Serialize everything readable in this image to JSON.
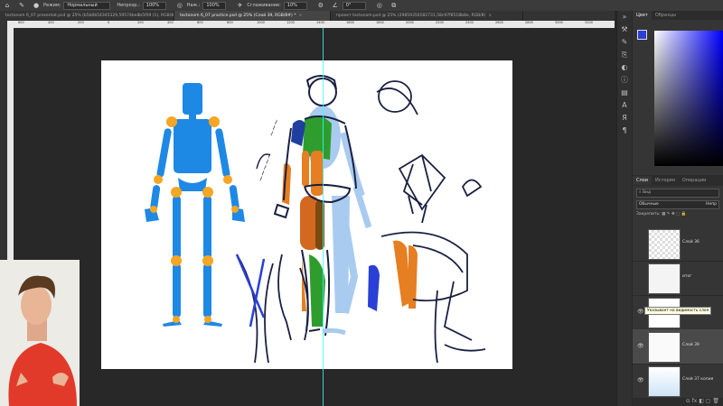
{
  "options_bar": {
    "mode_label": "Режим:",
    "mode_value": "Нормальный",
    "opacity_label": "Непрозр.:",
    "opacity_value": "100%",
    "flow_label": "Наж.:",
    "flow_value": "100%",
    "smoothing_label": "Сглаживание:",
    "smoothing_value": "10%",
    "angle_value": "0°"
  },
  "document_tabs": [
    {
      "title": "tectonom 6_07 presentat.psd @ 25% (b5b0b54345329,59574be8b5f09 (1), RGB/8)",
      "active": false
    },
    {
      "title": "tectonom 6_07 practice.psd @ 25% (Слой 39, RGB/8#) *",
      "active": true
    },
    {
      "title": "проект tectonom.psd @ 25% (29859350182731,58c97f8518b8e, RGB/8)",
      "active": false
    }
  ],
  "ruler_ticks": [
    "600",
    "400",
    "200",
    "0",
    "200",
    "400",
    "600",
    "800",
    "1000",
    "1200",
    "1400",
    "1600",
    "1800",
    "2000",
    "2200",
    "2400",
    "2600",
    "2800",
    "3000",
    "3200",
    "3400"
  ],
  "color_panel": {
    "tabs": [
      "Цвет",
      "Образцы"
    ],
    "foreground": "#2a3fd6",
    "background": "#ffffff"
  },
  "layers_panel": {
    "tabs": [
      "Слои",
      "История",
      "Операции"
    ],
    "filter_label": "Вид",
    "blend_mode": "Обычные",
    "opacity_short": "Непр",
    "lock_label": "Закрепить:",
    "tooltip": "Указывает на видимость слоя",
    "layers": [
      {
        "name": "Слой 36",
        "visible": false,
        "selected": false
      },
      {
        "name": "итог",
        "visible": false,
        "selected": false
      },
      {
        "name": "",
        "visible": true,
        "selected": false
      },
      {
        "name": "Слой 39",
        "visible": true,
        "selected": true
      },
      {
        "name": "Слой 37 копия",
        "visible": true,
        "selected": false
      }
    ],
    "status_icons": "⊝ fx ◧ ▢ 🗑"
  },
  "colors": {
    "mannequin_blue": "#1e88e5",
    "joint_orange": "#f5a623",
    "muscle_orange": "#e67e22",
    "muscle_green": "#2e9d2e",
    "light_blue": "#a9cbef",
    "guide_cyan": "#33ffff"
  }
}
